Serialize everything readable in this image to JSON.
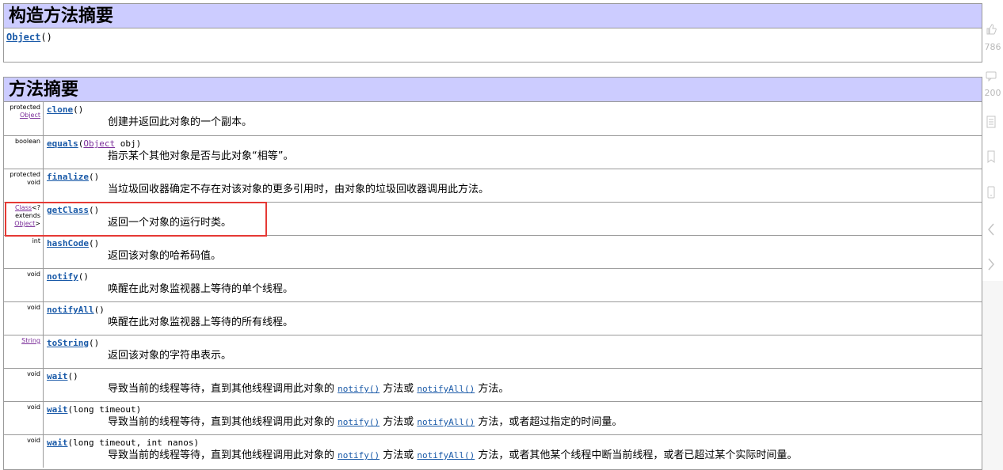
{
  "constructor_section": {
    "title": "构造方法摘要",
    "items": [
      {
        "name": "Object",
        "params": "()"
      }
    ]
  },
  "method_section": {
    "title": "方法摘要",
    "rows": [
      {
        "modifier": [
          "protected"
        ],
        "type_link": "Object",
        "type_suffix": [],
        "name": "clone",
        "params_pre": "()",
        "param_link": "",
        "params_post": "",
        "desc_parts": [
          "创建并返回此对象的一个副本。"
        ],
        "desc_links": []
      },
      {
        "modifier": [
          "boolean"
        ],
        "type_link": "",
        "type_suffix": [],
        "name": "equals",
        "params_pre": "(",
        "param_link": "Object",
        "params_post": " obj)",
        "desc_parts": [
          "指示某个其他对象是否与此对象“相等”。"
        ],
        "desc_links": []
      },
      {
        "modifier": [
          "protected",
          "void"
        ],
        "type_link": "",
        "type_suffix": [],
        "name": "finalize",
        "params_pre": "()",
        "param_link": "",
        "params_post": "",
        "desc_parts": [
          "当垃圾回收器确定不存在对该对象的更多引用时，由对象的垃圾回收器调用此方法。"
        ],
        "desc_links": []
      },
      {
        "modifier": [],
        "type_link": "Class",
        "type_suffix": [
          "<?",
          "extends"
        ],
        "type_link2": "Object",
        "type_suffix2": ">",
        "name": "getClass",
        "params_pre": "()",
        "param_link": "",
        "params_post": "",
        "desc_parts": [
          "返回一个对象的运行时类。"
        ],
        "desc_links": []
      },
      {
        "modifier": [
          "int"
        ],
        "type_link": "",
        "type_suffix": [],
        "name": "hashCode",
        "params_pre": "()",
        "param_link": "",
        "params_post": "",
        "desc_parts": [
          "返回该对象的哈希码值。"
        ],
        "desc_links": []
      },
      {
        "modifier": [
          "void"
        ],
        "type_link": "",
        "type_suffix": [],
        "name": "notify",
        "params_pre": "()",
        "param_link": "",
        "params_post": "",
        "desc_parts": [
          "唤醒在此对象监视器上等待的单个线程。"
        ],
        "desc_links": []
      },
      {
        "modifier": [
          "void"
        ],
        "type_link": "",
        "type_suffix": [],
        "name": "notifyAll",
        "params_pre": "()",
        "param_link": "",
        "params_post": "",
        "desc_parts": [
          "唤醒在此对象监视器上等待的所有线程。"
        ],
        "desc_links": []
      },
      {
        "modifier": [],
        "type_link": "String",
        "type_suffix": [],
        "name": "toString",
        "params_pre": "()",
        "param_link": "",
        "params_post": "",
        "desc_parts": [
          "返回该对象的字符串表示。"
        ],
        "desc_links": []
      },
      {
        "modifier": [
          "void"
        ],
        "type_link": "",
        "type_suffix": [],
        "name": "wait",
        "params_pre": "()",
        "param_link": "",
        "params_post": "",
        "desc_parts": [
          "导致当前的线程等待，直到其他线程调用此对象的 ",
          " 方法或 ",
          " 方法。"
        ],
        "desc_links": [
          "notify()",
          "notifyAll()"
        ]
      },
      {
        "modifier": [
          "void"
        ],
        "type_link": "",
        "type_suffix": [],
        "name": "wait",
        "params_pre": "(long timeout)",
        "param_link": "",
        "params_post": "",
        "desc_parts": [
          "导致当前的线程等待，直到其他线程调用此对象的 ",
          " 方法或 ",
          " 方法，或者超过指定的时间量。"
        ],
        "desc_links": [
          "notify()",
          "notifyAll()"
        ]
      },
      {
        "modifier": [
          "void"
        ],
        "type_link": "",
        "type_suffix": [],
        "name": "wait",
        "params_pre": "(long timeout, int nanos)",
        "param_link": "",
        "params_post": "",
        "desc_parts": [
          "导致当前的线程等待，直到其他线程调用此对象的 ",
          " 方法或 ",
          " 方法，或者其他某个线程中断当前线程，或者已超过某个实际时间量。"
        ],
        "desc_links": [
          "notify()",
          "notifyAll()"
        ]
      }
    ]
  },
  "sidebar": {
    "like_count": "786",
    "comment_count": "200",
    "icons": [
      "thumbs-up-icon",
      "comment-icon",
      "list-icon",
      "bookmark-icon",
      "phone-icon",
      "chevron-left-icon",
      "chevron-right-icon"
    ]
  },
  "colors": {
    "header_bg": "#ccccff",
    "link": "#1a5aa8",
    "type_link": "#7b2f9a",
    "highlight_border": "#e53935"
  }
}
